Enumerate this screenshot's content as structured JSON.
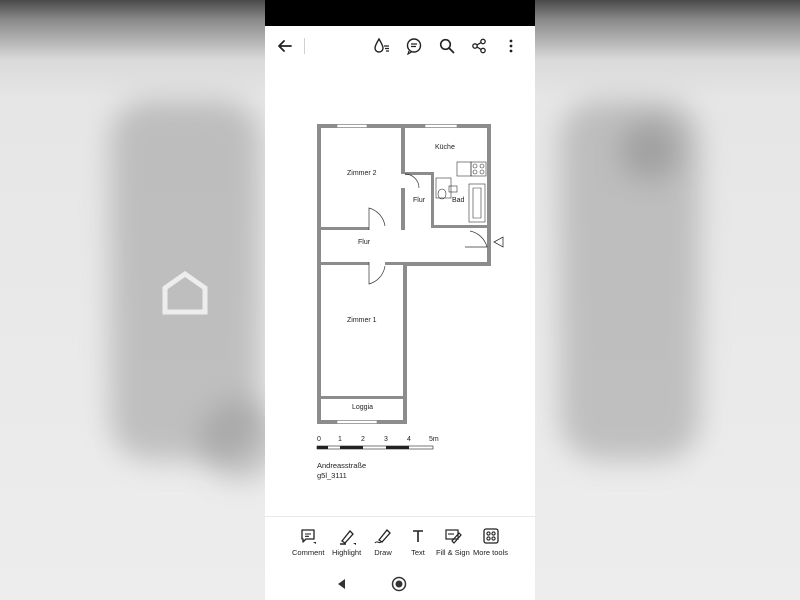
{
  "icons": {
    "back": "arrow-left-icon",
    "ink": "ink-drop-icon",
    "comments": "comment-list-icon",
    "search": "search-icon",
    "share": "share-icon",
    "more": "more-vertical-icon"
  },
  "floorplan": {
    "rooms": {
      "zimmer2": "Zimmer 2",
      "kueche": "Küche",
      "flur_top": "Flur",
      "bad": "Bad",
      "flur_mid": "Flur",
      "zimmer1": "Zimmer 1",
      "loggia": "Loggia"
    },
    "scale_labels": [
      "0",
      "1",
      "2",
      "3",
      "4",
      "5m"
    ],
    "street": "Andreasstraße",
    "plan_id": "g5l_3111"
  },
  "bottom_toolbar": {
    "comment": "Comment",
    "highlight": "Highlight",
    "draw": "Draw",
    "text": "Text",
    "fill_sign": "Fill & Sign",
    "more_tools": "More tools"
  },
  "colors": {
    "wall": "#8c8c8c",
    "toolbar_icon": "#222222",
    "background_overlay": "#eaeaea"
  }
}
